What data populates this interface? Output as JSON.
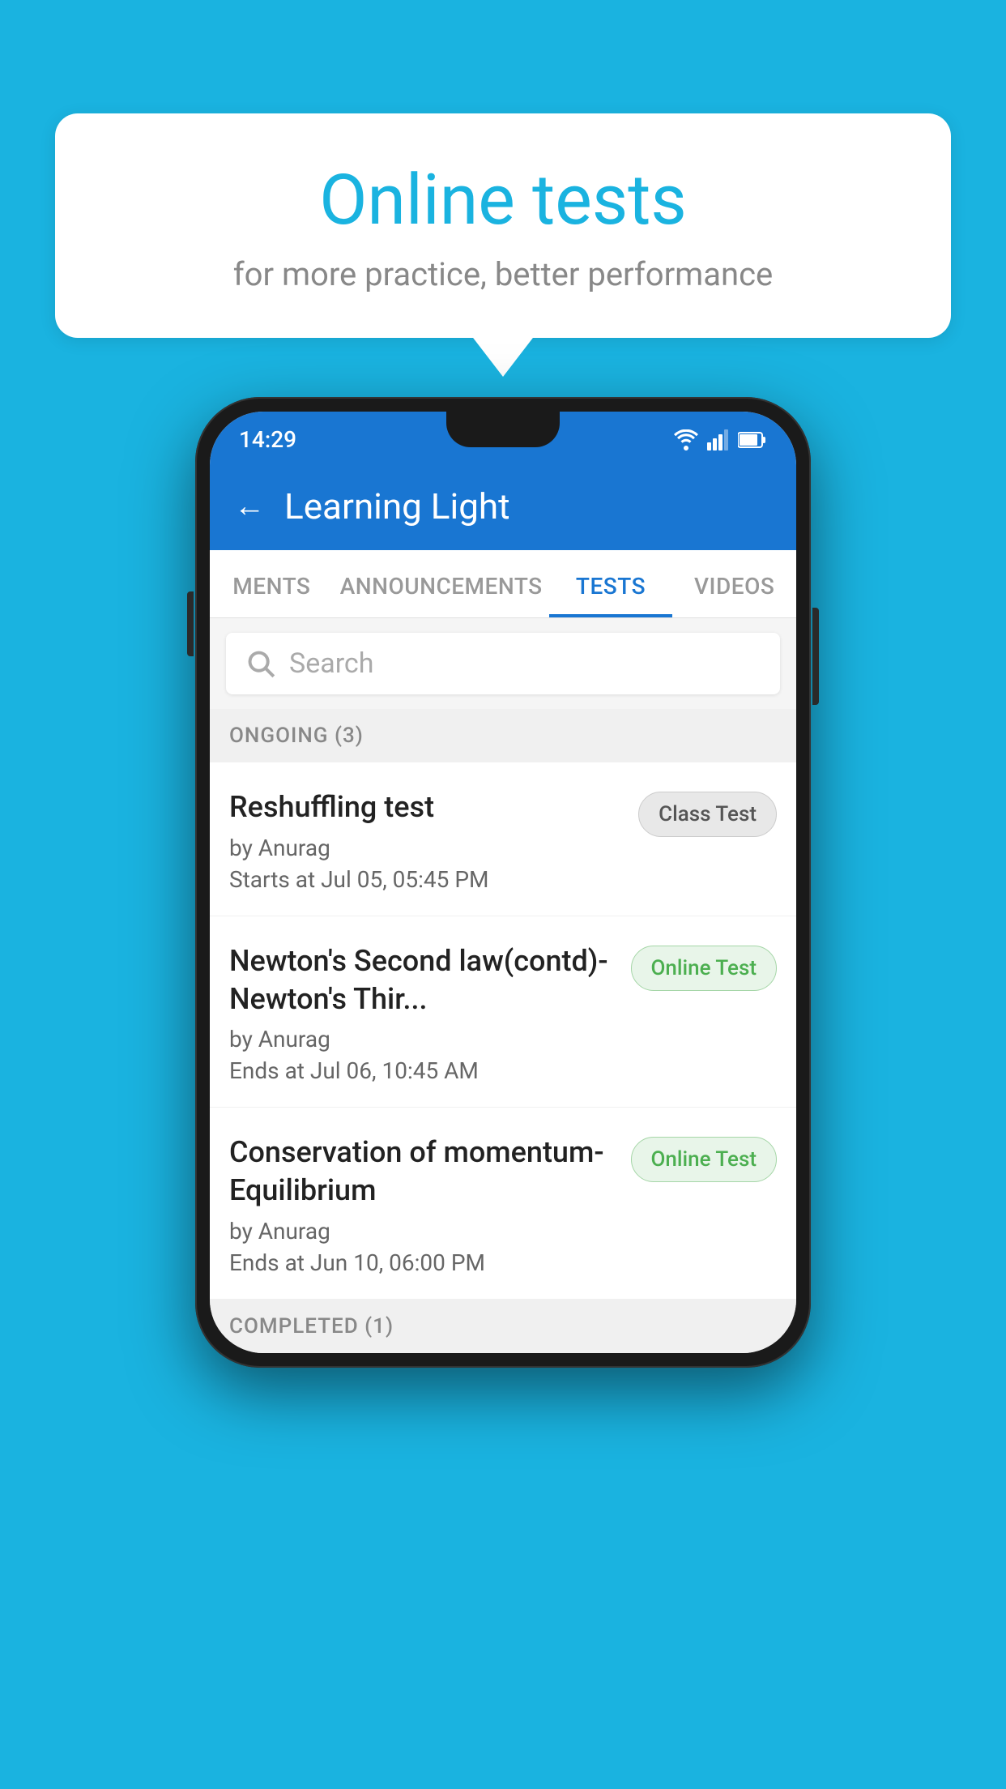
{
  "background_color": "#1ab3e0",
  "speech_bubble": {
    "title": "Online tests",
    "subtitle": "for more practice, better performance"
  },
  "phone": {
    "status_bar": {
      "time": "14:29",
      "icons": [
        "wifi",
        "signal",
        "battery"
      ]
    },
    "app_bar": {
      "title": "Learning Light",
      "back_label": "←"
    },
    "tabs": [
      {
        "label": "MENTS",
        "active": false
      },
      {
        "label": "ANNOUNCEMENTS",
        "active": false
      },
      {
        "label": "TESTS",
        "active": true
      },
      {
        "label": "VIDEOS",
        "active": false
      }
    ],
    "search": {
      "placeholder": "Search"
    },
    "ongoing_section": {
      "label": "ONGOING (3)"
    },
    "tests": [
      {
        "title": "Reshuffling test",
        "author": "by Anurag",
        "time_label": "Starts at",
        "time": "Jul 05, 05:45 PM",
        "badge": "Class Test",
        "badge_type": "class"
      },
      {
        "title": "Newton's Second law(contd)-Newton's Thir...",
        "author": "by Anurag",
        "time_label": "Ends at",
        "time": "Jul 06, 10:45 AM",
        "badge": "Online Test",
        "badge_type": "online"
      },
      {
        "title": "Conservation of momentum-Equilibrium",
        "author": "by Anurag",
        "time_label": "Ends at",
        "time": "Jun 10, 06:00 PM",
        "badge": "Online Test",
        "badge_type": "online"
      }
    ],
    "completed_section": {
      "label": "COMPLETED (1)"
    }
  }
}
